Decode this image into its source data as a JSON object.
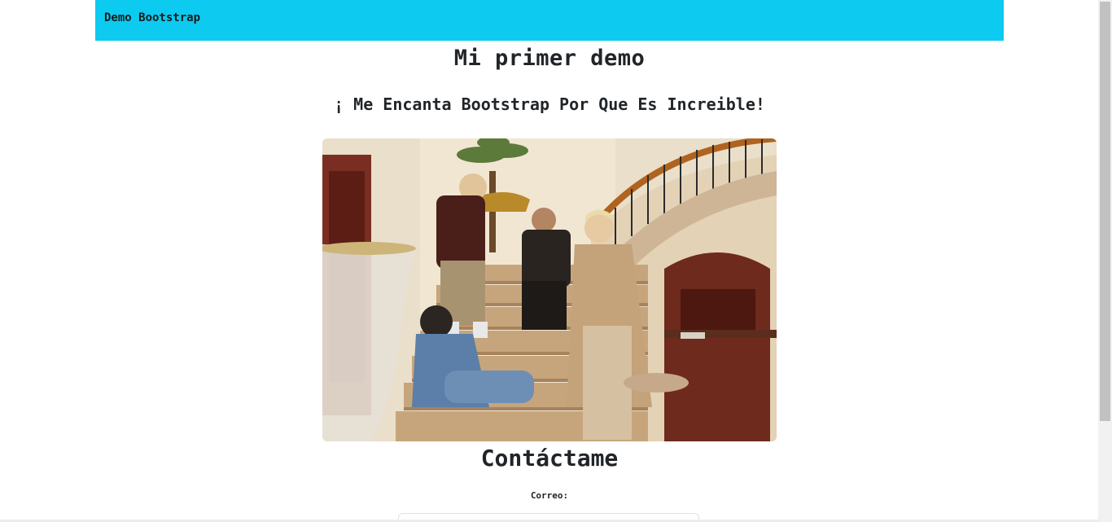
{
  "navbar": {
    "brand": "Demo Bootstrap",
    "color": "#0dcaf0"
  },
  "main": {
    "title": "Mi primer demo",
    "subtitle": "¡ Me Encanta Bootstrap Por Que Es Increible!",
    "image_alt": "Grupo de cuatro personas sentadas en una escalera"
  },
  "contact": {
    "title": "Contáctame",
    "email_label": "Correo:",
    "email_value": ""
  }
}
